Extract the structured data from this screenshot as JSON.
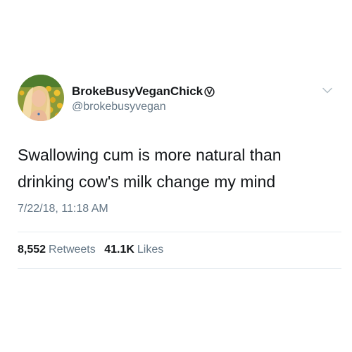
{
  "user": {
    "display_name": "BrokeBusyVeganChick",
    "badge_icon": "vegan-v-circle-icon",
    "handle": "@brokebusyvegan",
    "avatar": "profile-photo-woman-sunflowers"
  },
  "tweet": {
    "lines": [
      "Swallowing cum is more natural than",
      "drinking cow's milk change my mind"
    ],
    "timestamp": "7/22/18, 11:18 AM"
  },
  "stats": {
    "retweets_count": "8,552",
    "retweets_label": "Retweets",
    "likes_count": "41.1K",
    "likes_label": "Likes"
  },
  "menu_icon": "chevron-down-icon",
  "colors": {
    "primary_text": "#14171a",
    "secondary_text": "#657786",
    "divider": "#e6ecf0",
    "background": "#ffffff"
  }
}
